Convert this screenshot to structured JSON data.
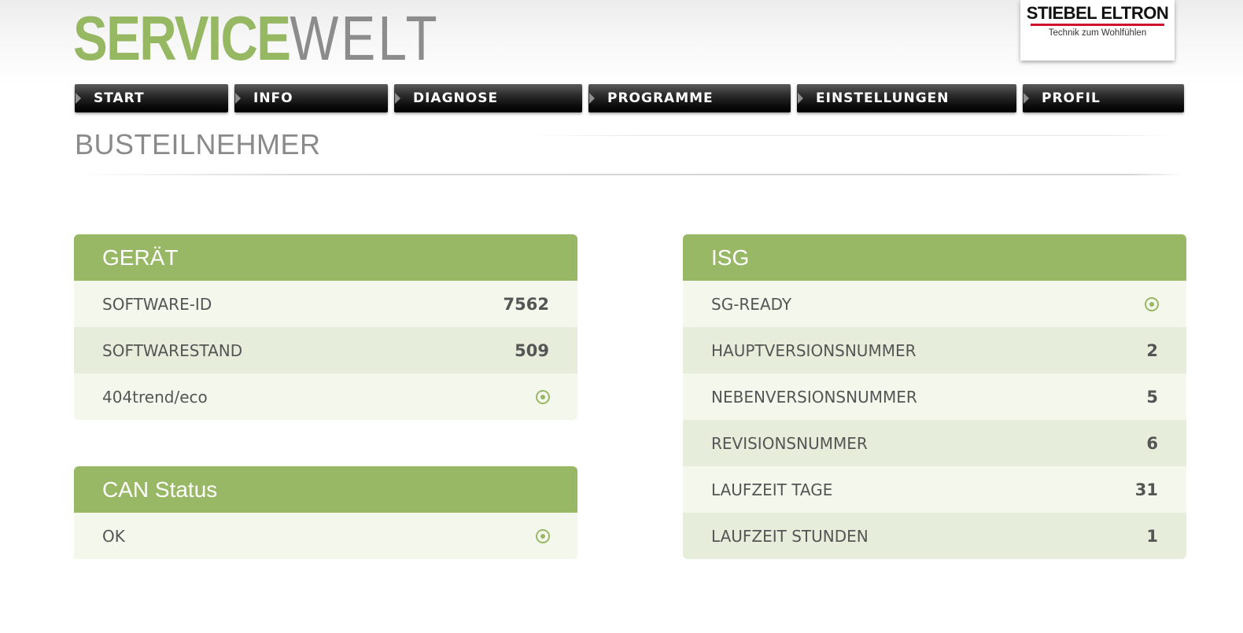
{
  "logo": {
    "part1": "SERVICE",
    "part2": "WELT"
  },
  "brand": {
    "name": "STIEBEL ELTRON",
    "tagline": "Technik zum Wohlfühlen"
  },
  "nav": [
    "START",
    "INFO",
    "DIAGNOSE",
    "PROGRAMME",
    "EINSTELLUNGEN",
    "PROFIL"
  ],
  "page": {
    "title": "BUSTEILNEHMER"
  },
  "geraet": {
    "title": "GERÄT",
    "rows": [
      {
        "label": "SOFTWARE-ID",
        "value": "7562"
      },
      {
        "label": "SOFTWARESTAND",
        "value": "509"
      },
      {
        "label": "404trend/eco",
        "icon": "status-dot-icon"
      }
    ]
  },
  "can": {
    "title": "CAN Status",
    "rows": [
      {
        "label": "OK",
        "icon": "status-dot-icon"
      }
    ]
  },
  "isg": {
    "title": "ISG",
    "rows": [
      {
        "label": "SG-READY",
        "icon": "status-dot-icon"
      },
      {
        "label": "HAUPTVERSIONSNUMMER",
        "value": "2"
      },
      {
        "label": "NEBENVERSIONSNUMMER",
        "value": "5"
      },
      {
        "label": "REVISIONSNUMMER",
        "value": "6"
      },
      {
        "label": "LAUFZEIT TAGE",
        "value": "31"
      },
      {
        "label": "LAUFZEIT STUNDEN",
        "value": "1"
      }
    ]
  },
  "colors": {
    "accent": "#98b865",
    "row_light": "#f3f7ec",
    "row_dark": "#e6eedb"
  }
}
